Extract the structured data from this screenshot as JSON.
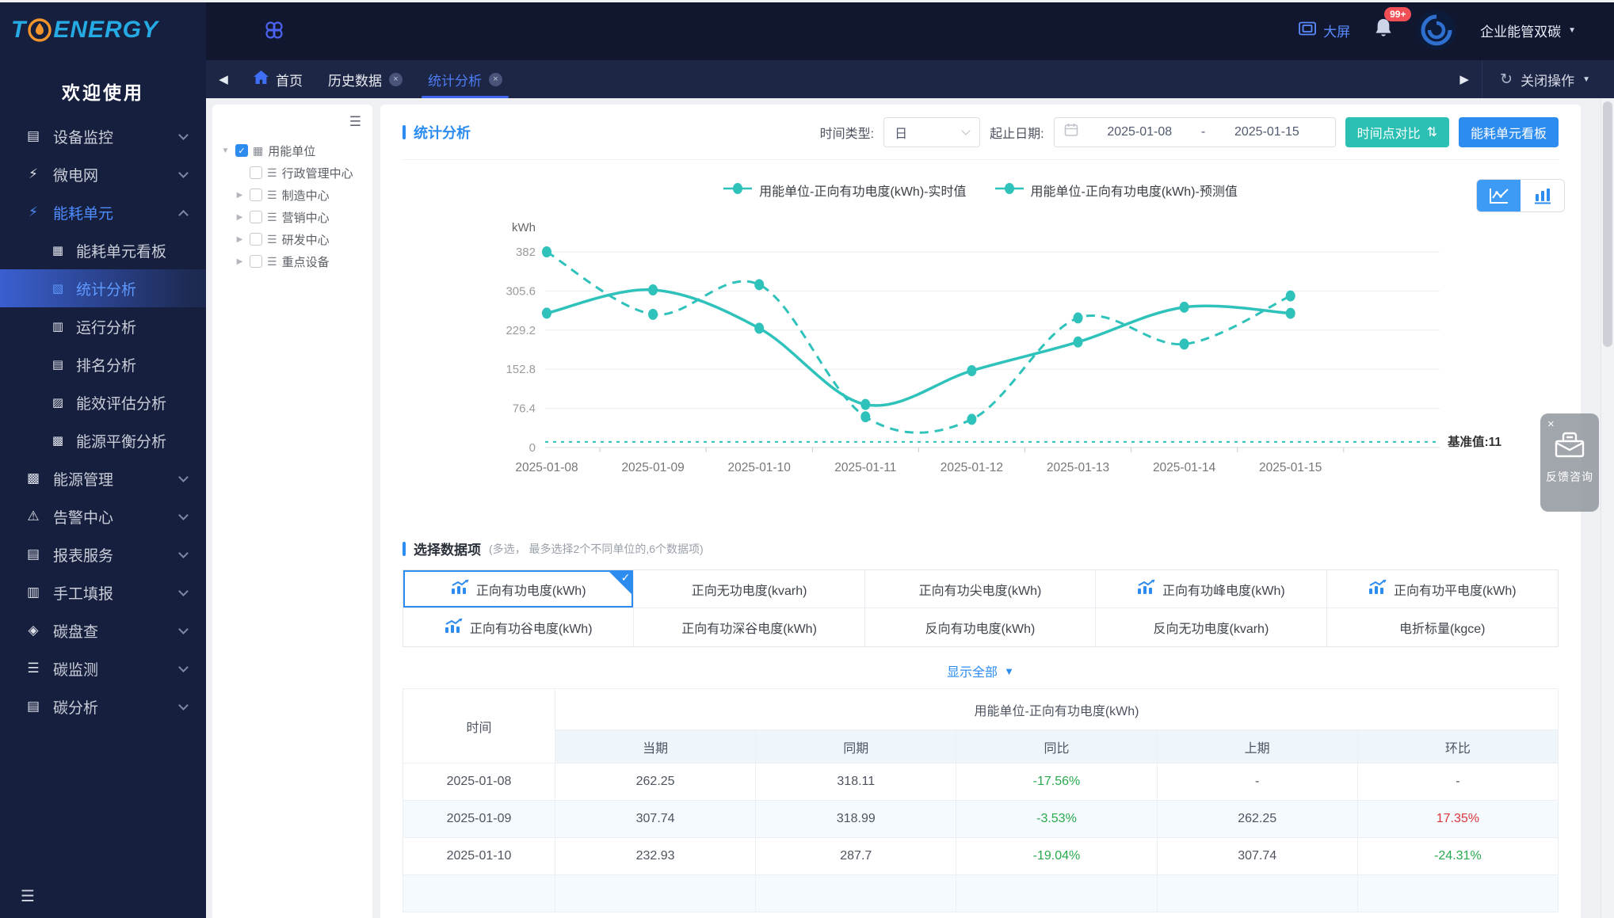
{
  "app": {
    "logo_t": "T",
    "logo_rest": "ENERGY",
    "welcome": "欢迎使用"
  },
  "icons": {
    "back": "◀",
    "forward": "▶",
    "refresh": "↻",
    "caret_down": "▼",
    "close": "×",
    "compare": "⇅",
    "check": "✓",
    "collapse": "☰",
    "tree_collapse": "☰"
  },
  "header": {
    "big_screen": "大屏",
    "badge": "99+",
    "org": "企业能管双碳",
    "close_ops": "关闭操作",
    "home_tab": "首页",
    "tabs": [
      {
        "key": "history-data",
        "label": "历史数据",
        "closable": true,
        "active": false
      },
      {
        "key": "stat-analysis",
        "label": "统计分析",
        "closable": true,
        "active": true
      }
    ]
  },
  "sidebar": {
    "items": [
      {
        "key": "device-monitor",
        "label": "设备监控",
        "icon": "▤",
        "icon_name": "device-monitor-icon",
        "chevron": true
      },
      {
        "key": "microgrid",
        "label": "微电网",
        "icon": "⚡",
        "icon_name": "microgrid-icon",
        "chevron": true
      },
      {
        "key": "energy-unit",
        "label": "能耗单元",
        "icon": "⚡",
        "icon_name": "energy-unit-icon",
        "chevron": true,
        "active": true,
        "expanded": true,
        "children": [
          {
            "key": "unit-board",
            "label": "能耗单元看板",
            "icon": "▦",
            "icon_name": "board-icon"
          },
          {
            "key": "stat-analysis",
            "label": "统计分析",
            "icon": "▧",
            "icon_name": "stat-analysis-icon",
            "active": true
          },
          {
            "key": "run-analysis",
            "label": "运行分析",
            "icon": "▥",
            "icon_name": "run-analysis-icon"
          },
          {
            "key": "rank-analysis",
            "label": "排名分析",
            "icon": "▤",
            "icon_name": "rank-analysis-icon"
          },
          {
            "key": "efficiency-eval",
            "label": "能效评估分析",
            "icon": "▨",
            "icon_name": "efficiency-eval-icon"
          },
          {
            "key": "energy-balance",
            "label": "能源平衡分析",
            "icon": "▩",
            "icon_name": "energy-balance-icon"
          }
        ]
      },
      {
        "key": "energy-mgmt",
        "label": "能源管理",
        "icon": "▩",
        "icon_name": "energy-mgmt-icon",
        "chevron": true
      },
      {
        "key": "alarm-center",
        "label": "告警中心",
        "icon": "⚠",
        "icon_name": "alarm-icon",
        "chevron": true
      },
      {
        "key": "report-service",
        "label": "报表服务",
        "icon": "▤",
        "icon_name": "report-icon",
        "chevron": true
      },
      {
        "key": "manual-entry",
        "label": "手工填报",
        "icon": "▥",
        "icon_name": "manual-entry-icon",
        "chevron": true
      },
      {
        "key": "carbon-audit",
        "label": "碳盘查",
        "icon": "◈",
        "icon_name": "carbon-audit-icon",
        "chevron": true
      },
      {
        "key": "carbon-monitor",
        "label": "碳监测",
        "icon": "☰",
        "icon_name": "carbon-monitor-icon",
        "chevron": true
      },
      {
        "key": "carbon-analysis",
        "label": "碳分析",
        "icon": "▤",
        "icon_name": "carbon-analysis-icon",
        "chevron": true
      }
    ]
  },
  "tree": {
    "root": {
      "key": "energy-org",
      "label": "用能单位",
      "checked": true,
      "expanded": true,
      "icon": "▦",
      "icon_name": "building-icon"
    },
    "children": [
      {
        "key": "admin-center",
        "label": "行政管理中心",
        "caret": false
      },
      {
        "key": "manufacture-center",
        "label": "制造中心",
        "caret": true
      },
      {
        "key": "marketing-center",
        "label": "营销中心",
        "caret": true
      },
      {
        "key": "rd-center",
        "label": "研发中心",
        "caret": true
      },
      {
        "key": "key-equipment",
        "label": "重点设备",
        "caret": true
      }
    ]
  },
  "panel": {
    "title": "统计分析",
    "time_type_label": "时间类型:",
    "time_type_value": "日",
    "date_label": "起止日期:",
    "date_start": "2025-01-08",
    "date_sep": "-",
    "date_end": "2025-01-15",
    "compare_btn": "时间点对比",
    "board_btn": "能耗单元看板"
  },
  "chart_data": {
    "type": "line",
    "unit": "kWh",
    "x": [
      "2025-01-08",
      "2025-01-09",
      "2025-01-10",
      "2025-01-11",
      "2025-01-12",
      "2025-01-13",
      "2025-01-14",
      "2025-01-15"
    ],
    "series": [
      {
        "name": "用能单位-正向有功电度(kWh)-实时值",
        "line": "solid",
        "values": [
          262.25,
          307.74,
          232.93,
          84,
          150,
          206,
          274,
          262
        ]
      },
      {
        "name": "用能单位-正向有功电度(kWh)-预测值",
        "line": "dashed",
        "values": [
          382,
          260,
          318,
          60,
          55,
          253,
          202,
          296
        ]
      }
    ],
    "y_ticks": [
      0,
      76.4,
      152.8,
      229.2,
      305.6,
      382
    ],
    "ylim": [
      0,
      382
    ],
    "baseline": {
      "label": "基准值:11",
      "value": 11
    },
    "color": "#2fc2bb",
    "grid": true,
    "legend_position": "top"
  },
  "selector": {
    "title": "选择数据项",
    "hint": "(多选， 最多选择2个不同单位的,6个数据项)",
    "show_all": "显示全部",
    "items": [
      {
        "key": "fwd-active",
        "label": "正向有功电度(kWh)",
        "icon": true,
        "selected": true
      },
      {
        "key": "fwd-reactive",
        "label": "正向无功电度(kvarh)",
        "icon": false,
        "selected": false
      },
      {
        "key": "fwd-sharp",
        "label": "正向有功尖电度(kWh)",
        "icon": false,
        "selected": false
      },
      {
        "key": "fwd-peak",
        "label": "正向有功峰电度(kWh)",
        "icon": true,
        "selected": false
      },
      {
        "key": "fwd-flat",
        "label": "正向有功平电度(kWh)",
        "icon": true,
        "selected": false
      },
      {
        "key": "fwd-valley",
        "label": "正向有功谷电度(kWh)",
        "icon": true,
        "selected": false
      },
      {
        "key": "fwd-deep-valley",
        "label": "正向有功深谷电度(kWh)",
        "icon": false,
        "selected": false
      },
      {
        "key": "rev-active",
        "label": "反向有功电度(kWh)",
        "icon": false,
        "selected": false
      },
      {
        "key": "rev-reactive",
        "label": "反向无功电度(kvarh)",
        "icon": false,
        "selected": false
      },
      {
        "key": "coal-equivalent",
        "label": "电折标量(kgce)",
        "icon": false,
        "selected": false
      }
    ]
  },
  "table": {
    "time_col": "时间",
    "group_header": "用能单位-正向有功电度(kWh)",
    "sub_cols": [
      "当期",
      "同期",
      "同比",
      "上期",
      "环比"
    ],
    "rows": [
      {
        "time": "2025-01-08",
        "cells": [
          {
            "v": "262.25"
          },
          {
            "v": "318.11"
          },
          {
            "v": "-17.56%",
            "c": "green"
          },
          {
            "v": "-"
          },
          {
            "v": "-"
          }
        ]
      },
      {
        "time": "2025-01-09",
        "cells": [
          {
            "v": "307.74"
          },
          {
            "v": "318.99"
          },
          {
            "v": "-3.53%",
            "c": "green"
          },
          {
            "v": "262.25"
          },
          {
            "v": "17.35%",
            "c": "red"
          }
        ]
      },
      {
        "time": "2025-01-10",
        "cells": [
          {
            "v": "232.93"
          },
          {
            "v": "287.7"
          },
          {
            "v": "-19.04%",
            "c": "green"
          },
          {
            "v": "307.74"
          },
          {
            "v": "-24.31%",
            "c": "green"
          }
        ]
      }
    ]
  },
  "feedback": {
    "label": "反馈咨询"
  },
  "colors": {
    "accent": "#2d8cf0",
    "teal": "#2fc2bb",
    "teal_btn": "#2bc0b3",
    "green": "#28a94d",
    "red": "#d9363c",
    "sidebar_bg": "#161f3d",
    "topbar_bg": "#10172f",
    "tabbar_bg": "#1d2644"
  }
}
